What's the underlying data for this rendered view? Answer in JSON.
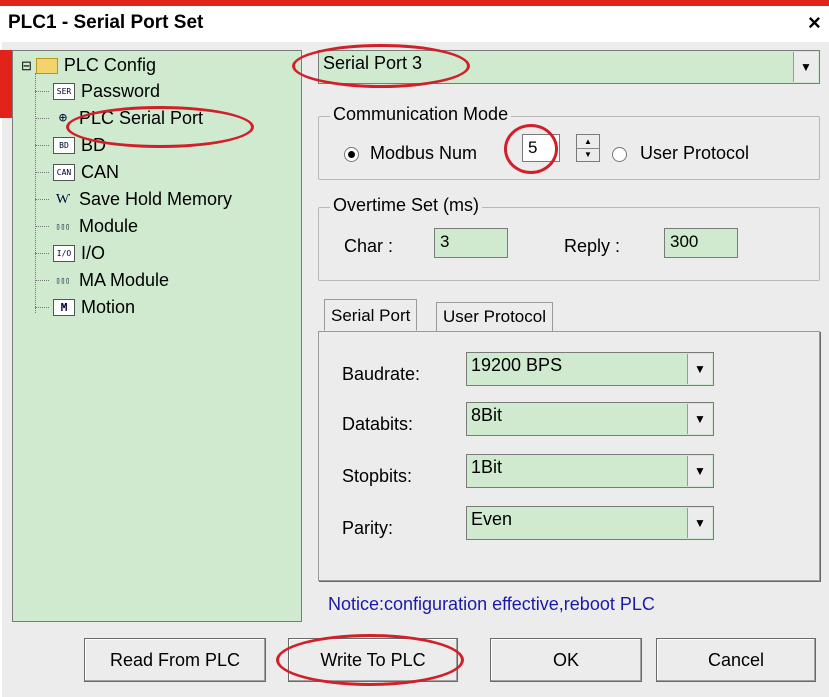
{
  "window": {
    "title": "PLC1 - Serial Port  Set",
    "close_label": "×"
  },
  "tree": {
    "root": {
      "expander": "⊟",
      "label": "PLC Config"
    },
    "items": [
      {
        "icon": "SER",
        "label": "Password"
      },
      {
        "icon": "⊕",
        "label": "PLC Serial Port"
      },
      {
        "icon": "BD",
        "label": "BD"
      },
      {
        "icon": "CAN",
        "label": "CAN"
      },
      {
        "icon": "Ⱳ",
        "label": "Save Hold Memory"
      },
      {
        "icon": "▯▯▯",
        "label": "Module"
      },
      {
        "icon": "I/O",
        "label": "I/O"
      },
      {
        "icon": "▯▯▯",
        "label": "MA Module"
      },
      {
        "icon": "M",
        "label": "Motion"
      }
    ]
  },
  "port_select": {
    "value": "Serial Port 3"
  },
  "comm_mode": {
    "group_label": "Communication Mode",
    "modbus_label": "Modbus Num",
    "modbus_value": "5",
    "user_protocol_label": "User Protocol",
    "selected": "modbus"
  },
  "overtime": {
    "group_label": "Overtime Set (ms)",
    "char_label": "Char :",
    "char_value": "3",
    "reply_label": "Reply :",
    "reply_value": "300"
  },
  "tabs": [
    {
      "label": "Serial Port",
      "active": true
    },
    {
      "label": "User Protocol",
      "active": false
    }
  ],
  "serial": {
    "baudrate_label": "Baudrate:",
    "baudrate_value": "19200 BPS",
    "databits_label": "Databits:",
    "databits_value": "8Bit",
    "stopbits_label": "Stopbits:",
    "stopbits_value": "1Bit",
    "parity_label": "Parity:",
    "parity_value": "Even"
  },
  "notice": "Notice:configuration effective,reboot PLC",
  "buttons": {
    "read": "Read From PLC",
    "write": "Write To PLC",
    "ok": "OK",
    "cancel": "Cancel"
  },
  "colors": {
    "field_bg": "#cfeacf",
    "annotation_red": "#d0202a",
    "notice_blue": "#1a1aa8"
  }
}
